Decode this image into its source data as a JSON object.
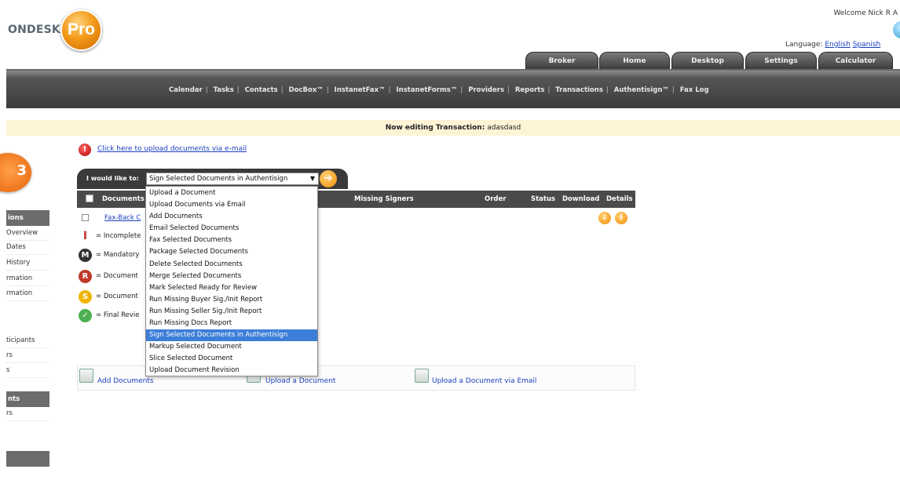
{
  "header": {
    "logo_text": "ONDESK",
    "logo_badge": "Pro",
    "welcome": "Welcome Nick R A",
    "language_label": "Language:",
    "language_options": [
      "English",
      "Spanish"
    ]
  },
  "tabs": [
    "Broker",
    "Home",
    "Desktop",
    "Settings",
    "Calculator"
  ],
  "nav_links": [
    "Calendar",
    "Tasks",
    "Contacts",
    "DocBox™",
    "InstanetFax™",
    "InstanetForms™",
    "Providers",
    "Reports",
    "Transactions",
    "Authentisign™",
    "Fax Log"
  ],
  "editing": {
    "label": "Now editing Transaction:",
    "value": "adasdasd"
  },
  "sidebar": {
    "badge": "3",
    "headers": [
      "ions",
      "nts",
      ""
    ],
    "items": [
      "Overview",
      "Dates",
      "History",
      "rmation",
      "rmation",
      "ticipants",
      "rs",
      "s",
      "rs"
    ]
  },
  "upload_email_link": "Click here to upload documents via e-mail",
  "action": {
    "label": "I would like to:",
    "selected": "Sign Selected Documents in Authentisign",
    "options": [
      "Upload a Document",
      "Upload Documents via Email",
      "Add Documents",
      "Email Selected Documents",
      "Fax Selected Documents",
      "Package Selected Documents",
      "Delete Selected Documents",
      "Merge Selected Documents",
      "Mark Selected Ready for Review",
      "Run Missing Buyer Sig./Init Report",
      "Run Missing Seller Sig./Init Report",
      "Run Missing Docs Report",
      "Sign Selected Documents in Authentisign",
      "Markup Selected Document",
      "Slice Selected Document",
      "Upload Document Revision"
    ],
    "selected_index": 12
  },
  "table": {
    "columns": [
      "Documents",
      "Missing Signers",
      "Order",
      "Status",
      "Download",
      "Details"
    ],
    "rows": [
      {
        "name": "Fax-Back C"
      }
    ]
  },
  "legend": [
    {
      "icon": "I",
      "text": "= Incomplete",
      "color": "#c0392b"
    },
    {
      "icon": "M",
      "text": "= Mandatory",
      "color": "#333333"
    },
    {
      "icon": "R",
      "text": "= Document",
      "color": "#c0392b"
    },
    {
      "icon": "S",
      "text": "= Document",
      "color": "#f0b400"
    },
    {
      "icon": "✓",
      "text": "= Final Revie",
      "color": "#4caf50"
    }
  ],
  "bottom_actions": [
    "Add Documents",
    "Upload a Document",
    "Upload a Document via Email"
  ]
}
